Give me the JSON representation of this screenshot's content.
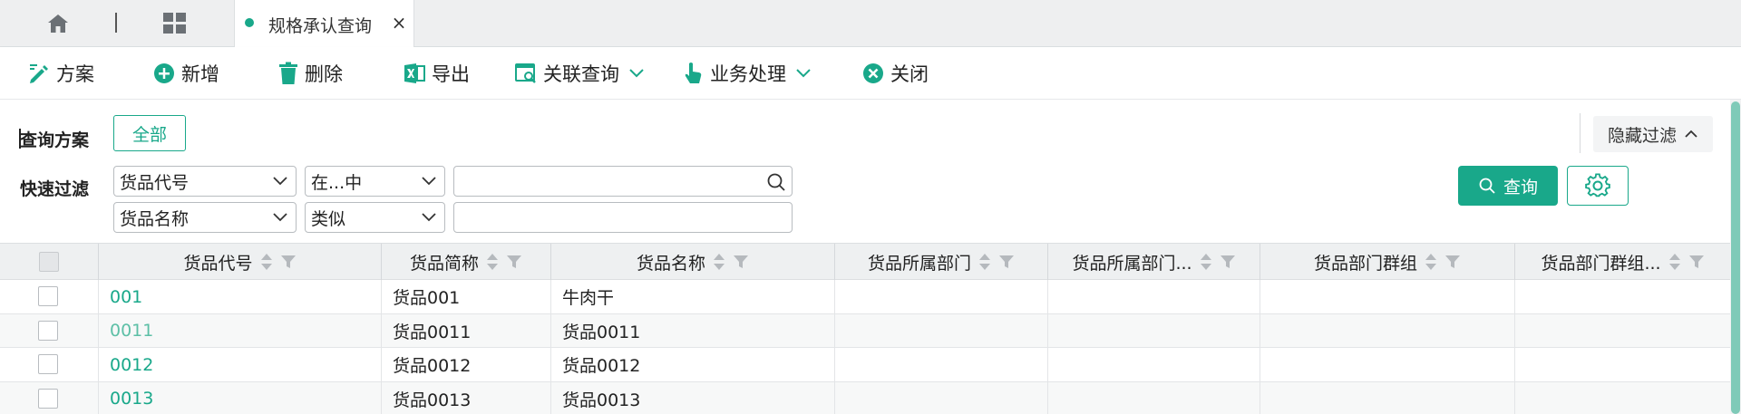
{
  "tabbar": {
    "tab_title": "规格承认查询",
    "close_glyph": "×"
  },
  "toolbar": {
    "items": [
      {
        "label": "方案",
        "icon": "scheme-pencil-icon"
      },
      {
        "label": "新增",
        "icon": "plus-circle-icon"
      },
      {
        "label": "删除",
        "icon": "trash-icon"
      },
      {
        "label": "导出",
        "icon": "excel-export-icon"
      },
      {
        "label": "关联查询",
        "icon": "linked-query-icon",
        "dropdown": true
      },
      {
        "label": "业务处理",
        "icon": "hand-pointer-icon",
        "dropdown": true
      },
      {
        "label": "关闭",
        "icon": "close-circle-icon"
      }
    ]
  },
  "filter": {
    "scheme_label": "查询方案",
    "scheme_button": "全部",
    "hide_filter": "隐藏过滤",
    "quick_label": "快速过滤",
    "rows": [
      {
        "field": "货品代号",
        "operator": "在...中",
        "value": ""
      },
      {
        "field": "货品名称",
        "operator": "类似",
        "value": ""
      }
    ],
    "query_button": "查询"
  },
  "table": {
    "columns": [
      "货品代号",
      "货品简称",
      "货品名称",
      "货品所属部门",
      "货品所属部门...",
      "货品部门群组",
      "货品部门群组..."
    ],
    "rows": [
      [
        "001",
        "货品001",
        "牛肉干",
        "",
        "",
        "",
        ""
      ],
      [
        "0011",
        "货品0011",
        "货品0011",
        "",
        "",
        "",
        ""
      ],
      [
        "0012",
        "货品0012",
        "货品0012",
        "",
        "",
        "",
        ""
      ],
      [
        "0013",
        "货品0013",
        "货品0013",
        "",
        "",
        "",
        ""
      ]
    ]
  },
  "colors": {
    "accent": "#19a88a",
    "tabbar_bg": "#eeeff0",
    "header_bg": "#eef0f1"
  }
}
